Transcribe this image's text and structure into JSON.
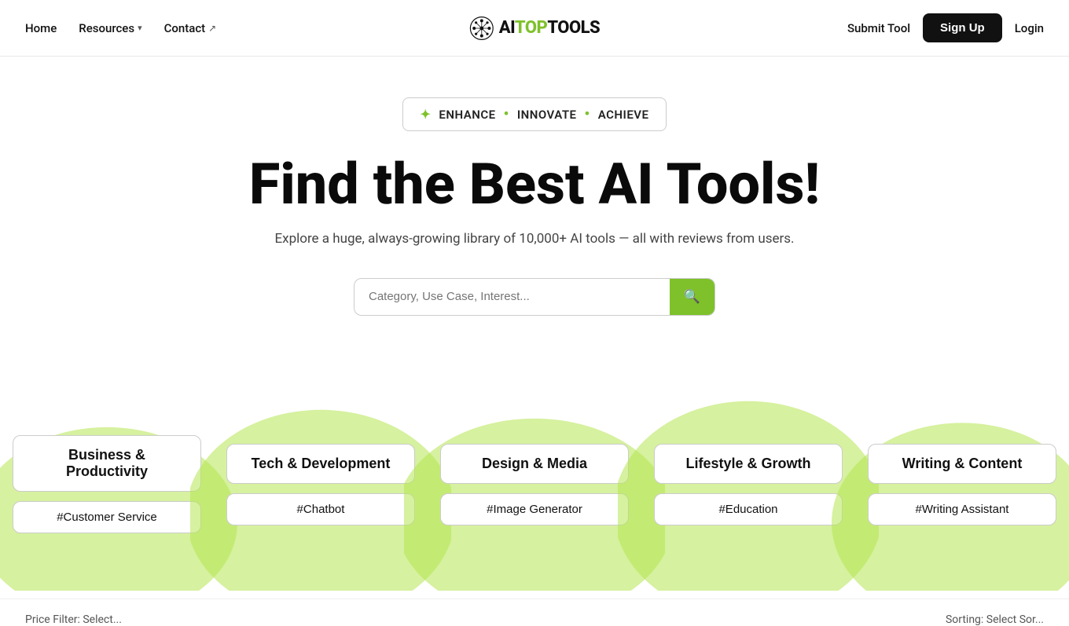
{
  "nav": {
    "home_label": "Home",
    "resources_label": "Resources",
    "contact_label": "Contact",
    "logo_text": "AITOPTOOLS",
    "logo_ai": "AI",
    "logo_top": "TOP",
    "logo_tools": "TOOLS",
    "submit_tool_label": "Submit Tool",
    "signup_label": "Sign Up",
    "login_label": "Login"
  },
  "hero": {
    "badge_star": "✦",
    "badge_enhance": "ENHANCE",
    "badge_dot1": "•",
    "badge_innovate": "INNOVATE",
    "badge_dot2": "•",
    "badge_achieve": "ACHIEVE",
    "title": "Find the Best AI Tools!",
    "subtitle": "Explore a huge, always-growing library of 10,000+ AI tools — all with reviews from users.",
    "search_placeholder": "Category, Use Case, Interest..."
  },
  "categories": [
    {
      "label": "Business & Productivity",
      "hashtag": "#Customer Service"
    },
    {
      "label": "Tech & Development",
      "hashtag": "#Chatbot"
    },
    {
      "label": "Design & Media",
      "hashtag": "#Image Generator"
    },
    {
      "label": "Lifestyle & Growth",
      "hashtag": "#Education"
    },
    {
      "label": "Writing & Content",
      "hashtag": "#Writing Assistant"
    }
  ],
  "bottom_filter": {
    "price_filter_label": "Price Filter: Select...",
    "sorting_label": "Sorting: Select Sor..."
  },
  "colors": {
    "green_accent": "#7ec12a",
    "blob_green": "#b5e550"
  }
}
